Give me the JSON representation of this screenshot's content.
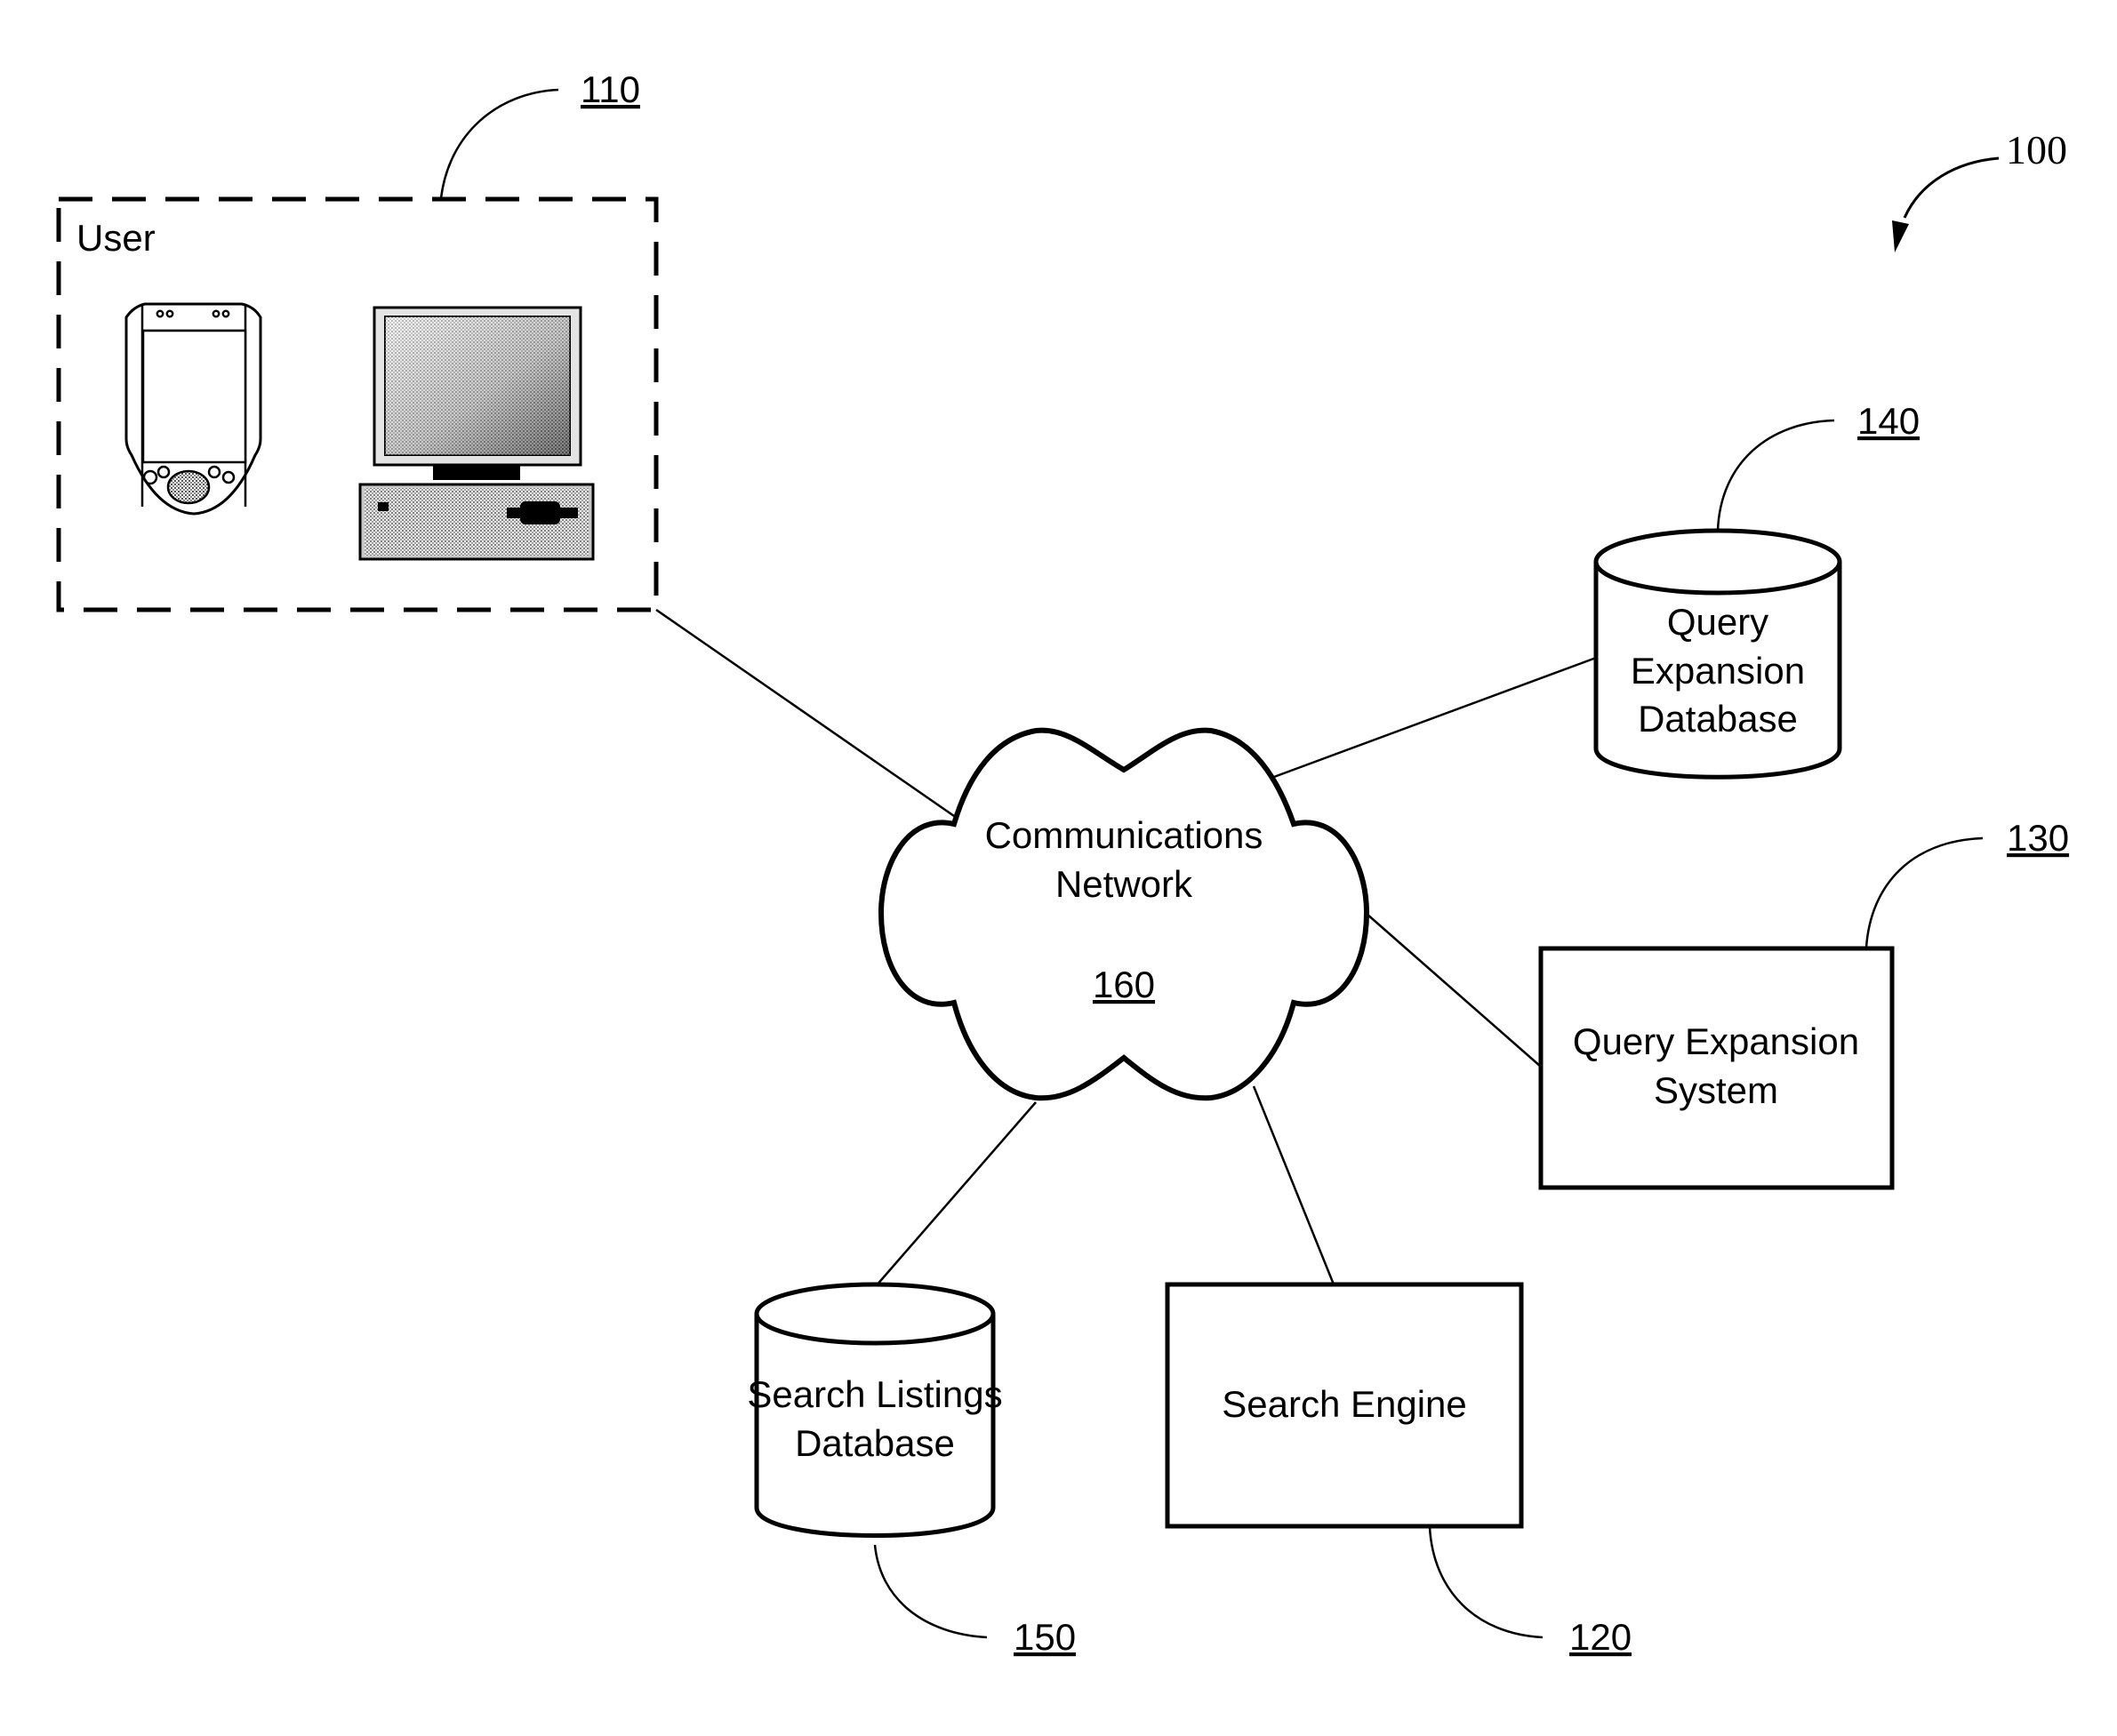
{
  "figure": {
    "figure_ref": "100",
    "colors": {
      "line": "#000000",
      "background": "#ffffff"
    }
  },
  "user": {
    "ref": "110",
    "title": "User",
    "devices": [
      {
        "icon": "pda-icon"
      },
      {
        "icon": "desktop-computer-icon"
      }
    ]
  },
  "network": {
    "ref": "160",
    "lines": [
      "Communications",
      "Network"
    ]
  },
  "query_expansion_database": {
    "ref": "140",
    "lines": [
      "Query",
      "Expansion",
      "Database"
    ]
  },
  "query_expansion_system": {
    "ref": "130",
    "lines": [
      "Query Expansion",
      "System"
    ]
  },
  "search_listings_database": {
    "ref": "150",
    "lines": [
      "Search Listings",
      "Database"
    ]
  },
  "search_engine": {
    "ref": "120",
    "lines": [
      "Search Engine"
    ]
  },
  "connections": [
    {
      "from": "user",
      "to": "network"
    },
    {
      "from": "network",
      "to": "query_expansion_database"
    },
    {
      "from": "network",
      "to": "query_expansion_system"
    },
    {
      "from": "network",
      "to": "search_listings_database"
    },
    {
      "from": "network",
      "to": "search_engine"
    }
  ]
}
